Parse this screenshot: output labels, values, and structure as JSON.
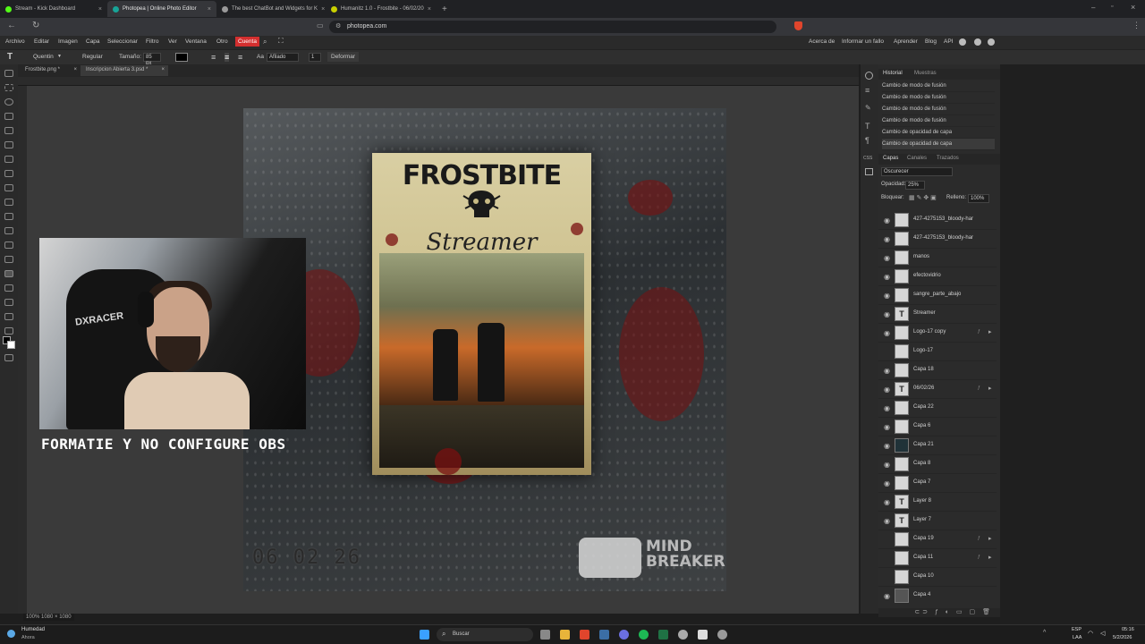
{
  "browser": {
    "tabs": [
      {
        "label": "Stream - Kick Dashboard",
        "color": "#53fc18"
      },
      {
        "label": "Photopea | Online Photo Editor",
        "color": "#18a497"
      },
      {
        "label": "The best ChatBot and Widgets for K",
        "color": "#9a9a9a"
      },
      {
        "label": "Humanitz 1.0 - Frostbite - 06/02/20",
        "color": "#c9d000"
      }
    ],
    "url": "photopea.com"
  },
  "menu": {
    "items": [
      "Archivo",
      "Editar",
      "Imagen",
      "Capa",
      "Seleccionar",
      "Filtro",
      "Ver",
      "Ventana",
      "Otro"
    ],
    "account": "Cuenta",
    "right_links": [
      "Acerca de",
      "Informar un fallo",
      "Aprender",
      "Blog",
      "API"
    ]
  },
  "options": {
    "font": "Quentin",
    "style": "Regular",
    "size_label": "Tamaño:",
    "size_value": "85 px",
    "aa_label": "Aa",
    "aa_value": "Afilado",
    "deform": "Deformar"
  },
  "documents": [
    "Frostbite.png *",
    "Inscripcion Abierta 3.psd *"
  ],
  "artwork": {
    "title": "FROSTBITE",
    "subtitle": "Streamer",
    "date": "06 02 26",
    "logo": [
      "MIND",
      "BREAKERS"
    ]
  },
  "webcam": {
    "chair_brand": "DXRACER"
  },
  "caption": "FORMATIE Y NO CONFIGURE OBS",
  "status": "100%  1080 × 1080",
  "history": {
    "tabs": [
      "Historial",
      "Muestras"
    ],
    "items": [
      "Cambio de modo de fusión",
      "Cambio de modo de fusión",
      "Cambio de modo de fusión",
      "Cambio de modo de fusión",
      "Cambio de opacidad de capa",
      "Cambio de opacidad de capa"
    ]
  },
  "layers_panel": {
    "tabs": [
      "Capas",
      "Canales",
      "Trazados"
    ],
    "blend_mode": "Oscurecer",
    "opacity_label": "Opacidad:",
    "opacity_value": "25%",
    "lock_label": "Bloquear:",
    "fill_label": "Relleno:",
    "fill_value": "100%",
    "layers": [
      {
        "name": "427-4275153_bloody-har",
        "visible": true,
        "text": false,
        "fx": false
      },
      {
        "name": "427-4275153_bloody-har",
        "visible": true,
        "text": false,
        "fx": false
      },
      {
        "name": "manos",
        "visible": true,
        "text": false,
        "fx": false
      },
      {
        "name": "efectovidrio",
        "visible": true,
        "text": false,
        "fx": false
      },
      {
        "name": "sangre_parte_abajo",
        "visible": true,
        "text": false,
        "fx": false
      },
      {
        "name": "Streamer",
        "visible": true,
        "text": true,
        "fx": false
      },
      {
        "name": "Logo-17 copy",
        "visible": true,
        "text": false,
        "fx": true
      },
      {
        "name": "Logo-17",
        "visible": false,
        "text": false,
        "fx": false
      },
      {
        "name": "Capa 18",
        "visible": true,
        "text": false,
        "fx": false
      },
      {
        "name": "06/02/26",
        "visible": true,
        "text": true,
        "fx": true
      },
      {
        "name": "Capa 22",
        "visible": true,
        "text": false,
        "fx": false
      },
      {
        "name": "Capa 6",
        "visible": true,
        "text": false,
        "fx": false
      },
      {
        "name": "Capa 21",
        "visible": true,
        "text": false,
        "fx": false
      },
      {
        "name": "Capa 8",
        "visible": true,
        "text": false,
        "fx": false
      },
      {
        "name": "Capa 7",
        "visible": true,
        "text": false,
        "fx": false
      },
      {
        "name": "Layer 8",
        "visible": true,
        "text": true,
        "fx": false
      },
      {
        "name": "Layer 7",
        "visible": true,
        "text": true,
        "fx": false
      },
      {
        "name": "Capa 19",
        "visible": false,
        "text": false,
        "fx": true
      },
      {
        "name": "Capa 11",
        "visible": false,
        "text": false,
        "fx": true
      },
      {
        "name": "Capa 10",
        "visible": false,
        "text": false,
        "fx": false
      },
      {
        "name": "Capa 4",
        "visible": true,
        "text": false,
        "fx": false
      }
    ]
  },
  "taskbar": {
    "weather_title": "Humedad",
    "weather_sub": "Ahora",
    "search": "Buscar",
    "lang": "ESP",
    "lang_sub": "LAA",
    "time": "05:16",
    "date": "5/2/2026"
  }
}
